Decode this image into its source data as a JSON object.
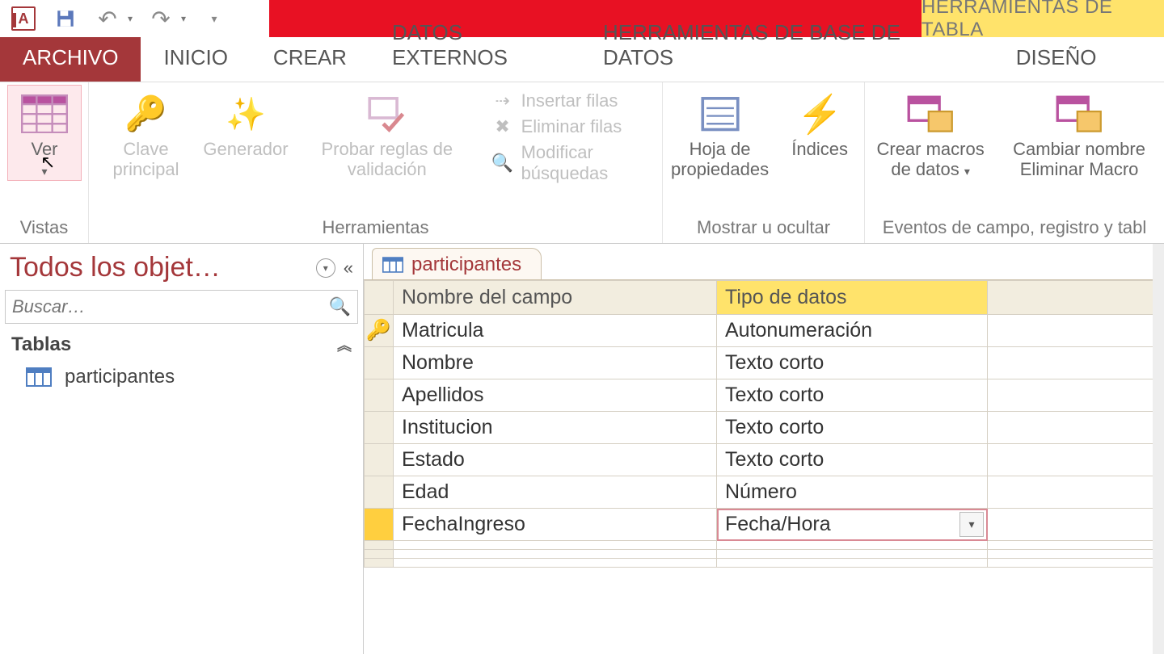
{
  "qat": {
    "context_title": "HERRAMIENTAS DE TABLA"
  },
  "tabs": {
    "file": "ARCHIVO",
    "items": [
      "INICIO",
      "CREAR",
      "DATOS EXTERNOS",
      "HERRAMIENTAS DE BASE DE DATOS"
    ],
    "design": "DISEÑO"
  },
  "ribbon": {
    "views": {
      "view_btn": "Ver",
      "group": "Vistas"
    },
    "tools": {
      "primary_key": "Clave principal",
      "builder": "Generador",
      "test_rules": "Probar reglas de validación",
      "insert_rows": "Insertar filas",
      "delete_rows": "Eliminar filas",
      "modify_lookups": "Modificar búsquedas",
      "group": "Herramientas"
    },
    "showhide": {
      "prop_sheet": "Hoja de propiedades",
      "indexes": "Índices",
      "group": "Mostrar u ocultar"
    },
    "events": {
      "create_macros": "Crear macros de datos",
      "rename_delete": "Cambiar nombre Eliminar Macro",
      "group": "Eventos de campo, registro y tabl"
    }
  },
  "nav": {
    "title": "Todos los objet…",
    "search_placeholder": "Buscar…",
    "group": "Tablas",
    "items": [
      "participantes"
    ]
  },
  "doc": {
    "tab": "participantes"
  },
  "design_grid": {
    "headers": {
      "name": "Nombre del campo",
      "type": "Tipo de datos"
    },
    "rows": [
      {
        "name": "Matricula",
        "type": "Autonumeración",
        "pk": true
      },
      {
        "name": "Nombre",
        "type": "Texto corto"
      },
      {
        "name": "Apellidos",
        "type": "Texto corto"
      },
      {
        "name": "Institucion",
        "type": "Texto corto"
      },
      {
        "name": "Estado",
        "type": "Texto corto"
      },
      {
        "name": "Edad",
        "type": "Número"
      },
      {
        "name": "FechaIngreso",
        "type": "Fecha/Hora",
        "active": true
      }
    ],
    "blank_rows": 3
  }
}
